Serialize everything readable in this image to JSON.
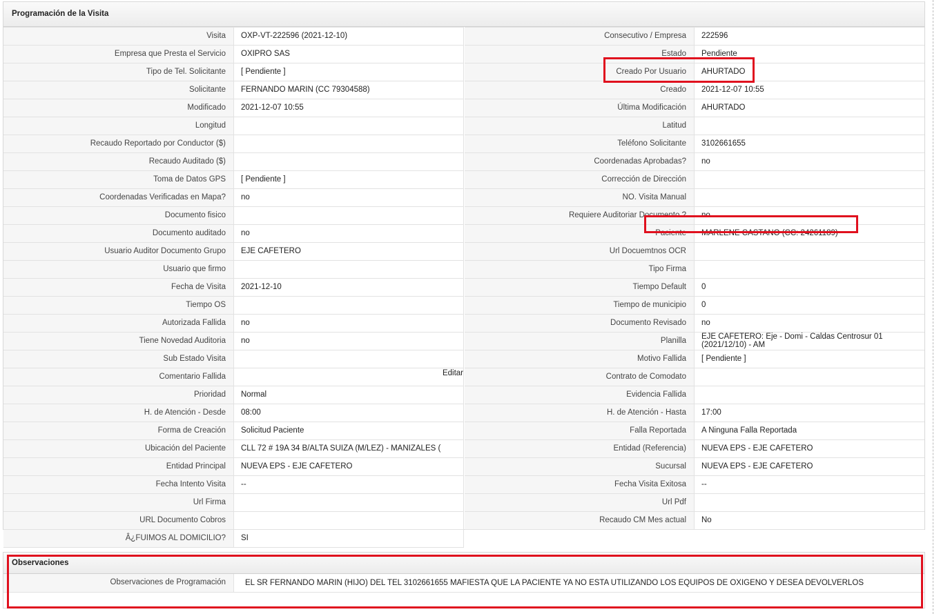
{
  "section_title": "Programación de la Visita",
  "left_rows": [
    {
      "label": "Visita",
      "value": "OXP-VT-222596 (2021-12-10)"
    },
    {
      "label": "Empresa que Presta el Servicio",
      "value": "OXIPRO SAS"
    },
    {
      "label": "Tipo de Tel. Solicitante",
      "value": "[ Pendiente ]"
    },
    {
      "label": "Solicitante",
      "value": "FERNANDO MARIN (CC 79304588)"
    },
    {
      "label": "Modificado",
      "value": "2021-12-07 10:55"
    },
    {
      "label": "Longitud",
      "value": ""
    },
    {
      "label": "Recaudo Reportado por Conductor ($)",
      "value": ""
    },
    {
      "label": "Recaudo Auditado ($)",
      "value": ""
    },
    {
      "label": "Toma de Datos GPS",
      "value": "[ Pendiente ]"
    },
    {
      "label": "Coordenadas Verificadas en Mapa?",
      "value": " no"
    },
    {
      "label": "Documento fisico",
      "value": ""
    },
    {
      "label": "Documento auditado",
      "value": " no"
    },
    {
      "label": "Usuario Auditor Documento Grupo",
      "value": "EJE CAFETERO"
    },
    {
      "label": "Usuario que firmo",
      "value": ""
    },
    {
      "label": "Fecha de Visita",
      "value": " 2021-12-10"
    },
    {
      "label": "Tiempo OS",
      "value": ""
    },
    {
      "label": "Autorizada Fallida",
      "value": " no"
    },
    {
      "label": "Tiene Novedad Auditoria",
      "value": " no"
    },
    {
      "label": "Sub Estado Visita",
      "value": ""
    },
    {
      "label": "Comentario Fallida",
      "value": "",
      "edit": "Editar"
    },
    {
      "label": "Prioridad",
      "value": "Normal"
    },
    {
      "label": "H. de Atención - Desde",
      "value": "08:00"
    },
    {
      "label": "Forma de Creación",
      "value": "Solicitud Paciente"
    },
    {
      "label": "Ubicación del Paciente",
      "value": "CLL 72 # 19A 34 B/ALTA SUIZA (M/LEZ) - MANIZALES ("
    },
    {
      "label": "Entidad Principal",
      "value": "NUEVA EPS - EJE CAFETERO"
    },
    {
      "label": "Fecha Intento Visita",
      "value": " --"
    },
    {
      "label": "Url Firma",
      "value": ""
    },
    {
      "label": "URL Documento Cobros",
      "value": ""
    },
    {
      "label": "Â¿FUIMOS AL DOMICILIO?",
      "value": "SI"
    }
  ],
  "right_rows": [
    {
      "label": "Consecutivo / Empresa",
      "value": "222596"
    },
    {
      "label": "Estado",
      "value": "Pendiente"
    },
    {
      "label": "Creado Por Usuario",
      "value": "AHURTADO"
    },
    {
      "label": "Creado",
      "value": "2021-12-07 10:55"
    },
    {
      "label": "Última Modificación",
      "value": " AHURTADO"
    },
    {
      "label": "Latitud",
      "value": ""
    },
    {
      "label": "Teléfono Solicitante",
      "value": "3102661655"
    },
    {
      "label": "Coordenadas Aprobadas?",
      "value": " no"
    },
    {
      "label": "Corrección de Dirección",
      "value": ""
    },
    {
      "label": "NO. Visita Manual",
      "value": ""
    },
    {
      "label": "Requiere Auditoriar Documento ?",
      "value": " no"
    },
    {
      "label": "Paciente",
      "value": "MARLENE CASTANO (CC: 24261189)"
    },
    {
      "label": "Url Docuemtnos OCR",
      "value": ""
    },
    {
      "label": "Tipo Firma",
      "value": ""
    },
    {
      "label": "Tiempo Default",
      "value": "0"
    },
    {
      "label": "Tiempo de municipio",
      "value": "0"
    },
    {
      "label": "Documento Revisado",
      "value": " no"
    },
    {
      "label": "Planilla",
      "value": "EJE CAFETERO: Eje - Domi - Caldas Centrosur 01 (2021/12/10) - AM",
      "two_line": true
    },
    {
      "label": "Motivo Fallida",
      "value": "[ Pendiente ]"
    },
    {
      "label": "Contrato de Comodato",
      "value": ""
    },
    {
      "label": "Evidencia Fallida",
      "value": ""
    },
    {
      "label": "H. de Atención - Hasta",
      "value": "17:00"
    },
    {
      "label": "Falla Reportada",
      "value": "A Ninguna Falla Reportada"
    },
    {
      "label": "Entidad (Referencia)",
      "value": "NUEVA EPS - EJE CAFETERO"
    },
    {
      "label": "Sucursal",
      "value": "NUEVA EPS - EJE CAFETERO"
    },
    {
      "label": "Fecha Visita Exitosa",
      "value": " --"
    },
    {
      "label": "Url Pdf",
      "value": ""
    },
    {
      "label": "Recaudo CM Mes actual",
      "value": "No"
    }
  ],
  "observaciones": {
    "title": "Observaciones",
    "label": "Observaciones de Programación",
    "value": "EL SR FERNANDO MARIN (HIJO) DEL TEL 3102661655 MAFIESTA QUE LA PACIENTE YA NO ESTA UTILIZANDO LOS EQUIPOS DE OXIGENO Y DESEA DEVOLVERLOS"
  },
  "colors": {
    "highlight": "#e0101e",
    "label_bg": "#f6f6f6",
    "border": "#e2e2e2"
  }
}
